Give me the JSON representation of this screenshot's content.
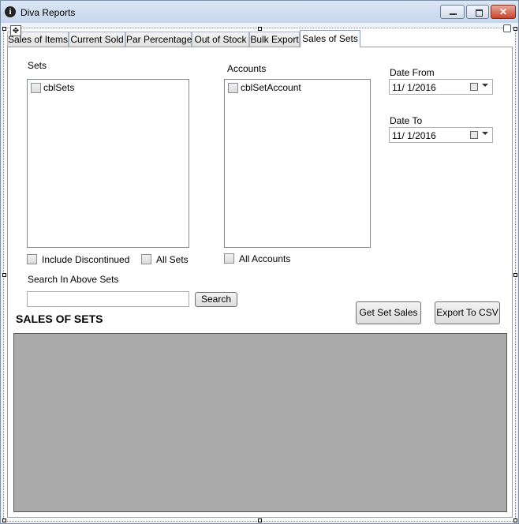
{
  "window": {
    "title": "Diva Reports",
    "icon": "diva-app-icon",
    "controls": {
      "close_glyph": "✕"
    }
  },
  "tabs": [
    {
      "label": "Sales of Items"
    },
    {
      "label": "Current Sold"
    },
    {
      "label": "Par Percentage"
    },
    {
      "label": "Out of Stock"
    },
    {
      "label": "Bulk Export"
    },
    {
      "label": "Sales of Sets",
      "active": true
    }
  ],
  "sets": {
    "label": "Sets",
    "items": [
      "cblSets"
    ],
    "include_discontinued_label": "Include Discontinued",
    "all_sets_label": "All Sets"
  },
  "accounts": {
    "label": "Accounts",
    "items": [
      "cblSetAccount"
    ],
    "all_accounts_label": "All Accounts"
  },
  "date_from": {
    "label": "Date From",
    "value": "11/  1/2016"
  },
  "date_to": {
    "label": "Date To",
    "value": "11/  1/2016"
  },
  "search": {
    "label": "Search In Above Sets",
    "value": "",
    "button_label": "Search"
  },
  "actions": {
    "get_set_sales_label": "Get Set Sales",
    "export_csv_label": "Export To CSV"
  },
  "results": {
    "heading": "SALES OF SETS"
  },
  "colors": {
    "grid_background": "#ababab",
    "title_bar": "#c6d6ea",
    "close_button": "#c7452c"
  }
}
